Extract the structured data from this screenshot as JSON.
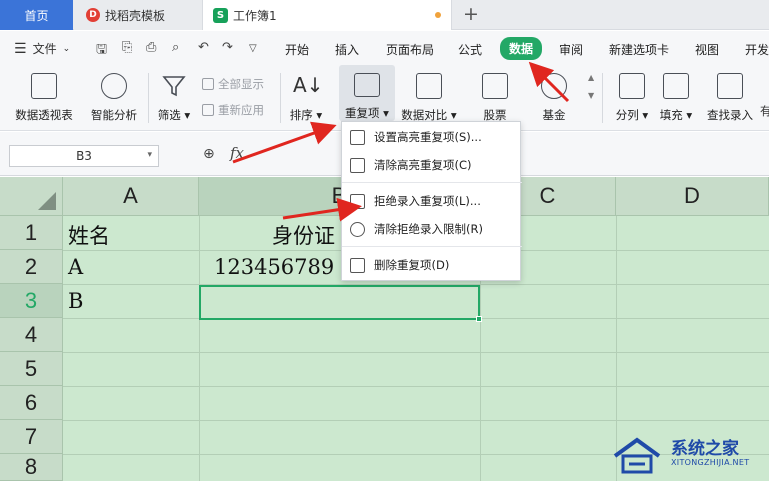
{
  "tabs": {
    "home": "首页",
    "template": "找稻壳模板",
    "workbook": "工作簿1",
    "add": "+"
  },
  "menu": {
    "file": "文件",
    "items": [
      "开始",
      "插入",
      "页面布局",
      "公式",
      "数据",
      "审阅",
      "新建选项卡",
      "视图",
      "开发"
    ],
    "active": "数据"
  },
  "ribbon": {
    "pivot": "数据透视表",
    "smart_analysis": "智能分析",
    "filter": "筛选",
    "show_all": "全部显示",
    "reapply": "重新应用",
    "sort": "排序",
    "duplicates": "重复项",
    "compare": "数据对比",
    "stock": "股票",
    "fund": "基金",
    "split": "分列",
    "fill": "填充",
    "lookup_entry": "查找录入",
    "more": "有"
  },
  "formula_bar": {
    "cell_ref": "B3",
    "fx": "fx"
  },
  "grid": {
    "columns": [
      "A",
      "B",
      "C",
      "D"
    ],
    "rows": [
      "1",
      "2",
      "3",
      "4",
      "5",
      "6",
      "7",
      "8"
    ],
    "cells": {
      "A1": "姓名",
      "B1": "身份证",
      "A2": "A",
      "B2": "123456789",
      "A3": "B"
    }
  },
  "dropdown": {
    "items": [
      "设置高亮重复项(S)...",
      "清除高亮重复项(C)",
      "拒绝录入重复项(L)...",
      "清除拒绝录入限制(R)",
      "删除重复项(D)"
    ]
  },
  "watermark": {
    "title": "系统之家",
    "subtitle": "XITONGZHIJIA.NET"
  },
  "colors": {
    "accent_green": "#23a866",
    "tab_blue": "#3b74d8",
    "grid_green": "#cce8cf",
    "arrow_red": "#e0261f"
  }
}
